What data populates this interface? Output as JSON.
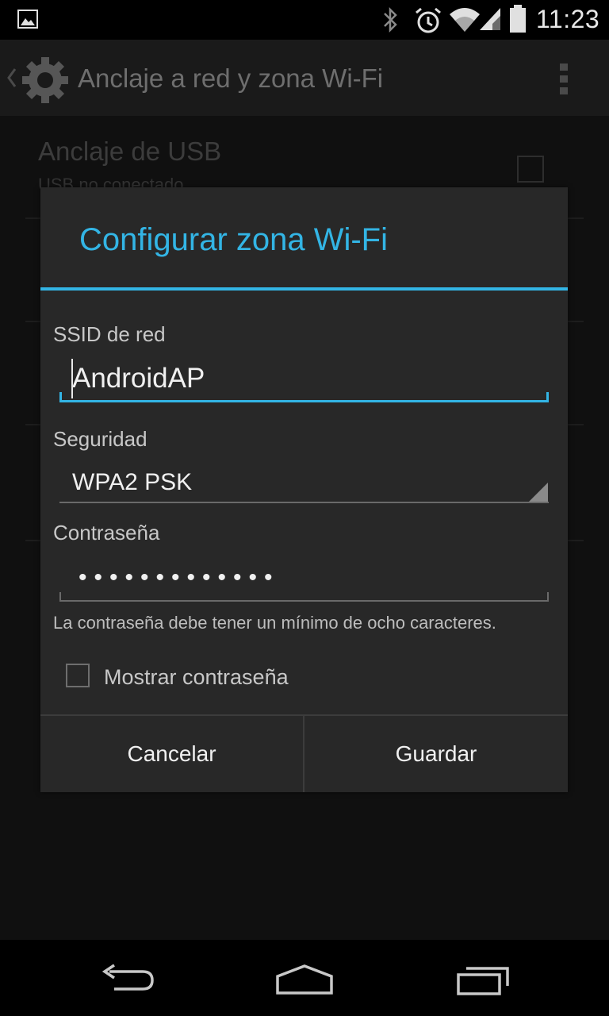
{
  "status_bar": {
    "time": "11:23",
    "icons": [
      "gallery-icon",
      "bluetooth-icon",
      "alarm-icon",
      "wifi-icon",
      "cell-signal-icon",
      "battery-icon"
    ]
  },
  "action_bar": {
    "title": "Anclaje a red y zona Wi-Fi",
    "icons": [
      "back-caret-icon",
      "settings-gear-icon",
      "overflow-menu-icon"
    ]
  },
  "background_list": {
    "items": [
      {
        "title": "Anclaje de USB",
        "subtitle": "USB no conectado"
      }
    ]
  },
  "dialog": {
    "title": "Configurar zona Wi-Fi",
    "ssid_label": "SSID de red",
    "ssid_value": "AndroidAP",
    "security_label": "Seguridad",
    "security_value": "WPA2 PSK",
    "password_label": "Contraseña",
    "password_value": "•••••••••••••",
    "password_hint": "La contraseña debe tener un mínimo de ocho caracteres.",
    "show_password_label": "Mostrar contraseña",
    "show_password_checked": false,
    "cancel_label": "Cancelar",
    "save_label": "Guardar"
  },
  "colors": {
    "accent": "#33b5e5",
    "dialog_bg": "#282828",
    "text_primary": "#f0f0f0"
  },
  "nav_bar": {
    "icons": [
      "back-icon",
      "home-icon",
      "recents-icon"
    ]
  }
}
